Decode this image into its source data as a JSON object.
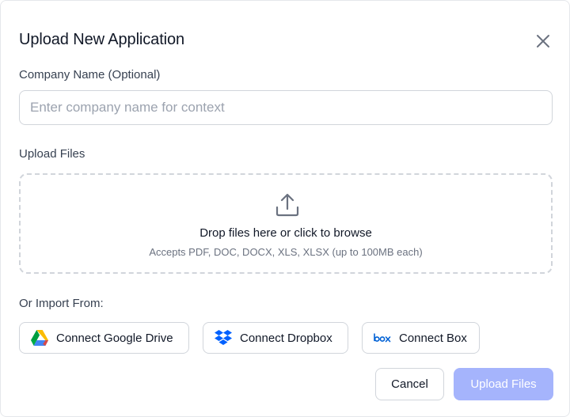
{
  "dialog": {
    "title": "Upload New Application"
  },
  "company": {
    "label": "Company Name (Optional)",
    "value": "",
    "placeholder": "Enter company name for context"
  },
  "upload": {
    "label": "Upload Files",
    "drop_text": "Drop files here or click to browse",
    "accepts_text": "Accepts PDF, DOC, DOCX, XLS, XLSX (up to 100MB each)",
    "icon": "upload-icon"
  },
  "import": {
    "label": "Or Import From:",
    "providers": [
      {
        "label": "Connect Google Drive",
        "icon": "google-drive-icon"
      },
      {
        "label": "Connect Dropbox",
        "icon": "dropbox-icon",
        "color": "#0061FF"
      },
      {
        "label": "Connect Box",
        "icon": "box-icon",
        "color": "#0061D5"
      }
    ]
  },
  "actions": {
    "cancel_label": "Cancel",
    "submit_label": "Upload Files",
    "submit_color": "#a5b4fc"
  }
}
